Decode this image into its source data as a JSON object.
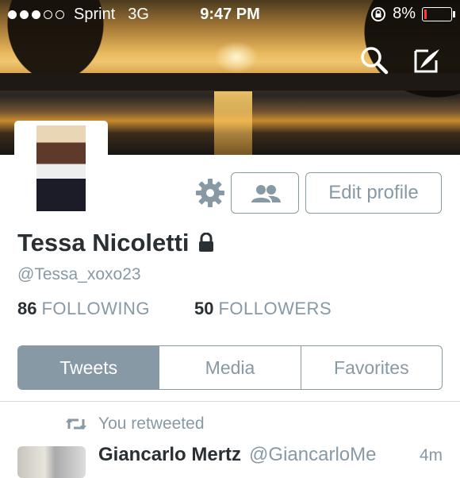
{
  "status_bar": {
    "signal_bars": 5,
    "signal_filled": 3,
    "carrier": "Sprint",
    "network": "3G",
    "time": "9:47 PM",
    "battery_text": "8%",
    "battery_level": 0.08,
    "battery_color": "#ff3b30"
  },
  "header": {
    "icons": [
      "search-icon",
      "compose-icon"
    ]
  },
  "profile": {
    "name": "Tessa Nicoletti",
    "handle": "@Tessa_xoxo23",
    "protected": true,
    "edit_profile_label": "Edit profile",
    "following_count": "86",
    "following_label": "FOLLOWING",
    "followers_count": "50",
    "followers_label": "FOLLOWERS"
  },
  "tabs": [
    {
      "label": "Tweets",
      "active": true
    },
    {
      "label": "Media",
      "active": false
    },
    {
      "label": "Favorites",
      "active": false
    }
  ],
  "timeline": {
    "retweet_label": "You retweeted",
    "tweet": {
      "name": "Giancarlo Mertz",
      "handle": "@GiancarloMe",
      "time": "4m"
    }
  },
  "colors": {
    "accent_gray": "#8899a6",
    "text_dark": "#292f33"
  }
}
